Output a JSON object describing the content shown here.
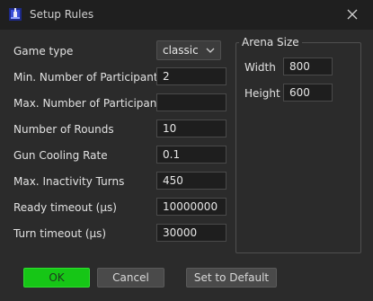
{
  "window": {
    "title": "Setup Rules"
  },
  "form": {
    "game_type": {
      "label": "Game type",
      "value": "classic"
    },
    "min_participants": {
      "label": "Min. Number of Participants",
      "value": "2"
    },
    "max_participants": {
      "label": "Max. Number of Participants",
      "value": ""
    },
    "rounds": {
      "label": "Number of Rounds",
      "value": "10"
    },
    "gun_cooling": {
      "label": "Gun Cooling Rate",
      "value": "0.1"
    },
    "inactivity": {
      "label": "Max. Inactivity Turns",
      "value": "450"
    },
    "ready_timeout": {
      "label": "Ready timeout (µs)",
      "value": "10000000"
    },
    "turn_timeout": {
      "label": "Turn timeout (µs)",
      "value": "30000"
    }
  },
  "arena": {
    "title": "Arena Size",
    "width": {
      "label": "Width",
      "value": "800"
    },
    "height": {
      "label": "Height",
      "value": "600"
    }
  },
  "buttons": {
    "ok": "OK",
    "cancel": "Cancel",
    "set_default": "Set to Default"
  },
  "icons": {
    "app": "robot-tank-icon",
    "close": "close-icon",
    "dropdown": "chevron-down-icon"
  },
  "colors": {
    "ok_button": "#16c616",
    "background": "#2b2b2b",
    "titlebar": "#1f1f1f"
  }
}
